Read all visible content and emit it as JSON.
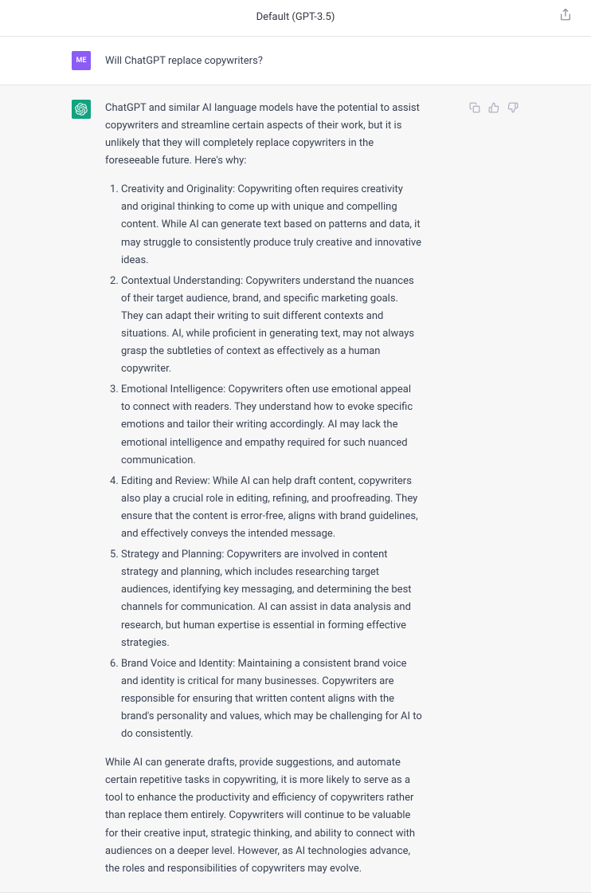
{
  "header": {
    "title": "Default (GPT-3.5)"
  },
  "user": {
    "avatar_text": "ME",
    "message": "Will ChatGPT replace copywriters?"
  },
  "assistant": {
    "intro": "ChatGPT and similar AI language models have the potential to assist copywriters and streamline certain aspects of their work, but it is unlikely that they will completely replace copywriters in the foreseeable future. Here's why:",
    "points": [
      "Creativity and Originality: Copywriting often requires creativity and original thinking to come up with unique and compelling content. While AI can generate text based on patterns and data, it may struggle to consistently produce truly creative and innovative ideas.",
      "Contextual Understanding: Copywriters understand the nuances of their target audience, brand, and specific marketing goals. They can adapt their writing to suit different contexts and situations. AI, while proficient in generating text, may not always grasp the subtleties of context as effectively as a human copywriter.",
      "Emotional Intelligence: Copywriters often use emotional appeal to connect with readers. They understand how to evoke specific emotions and tailor their writing accordingly. AI may lack the emotional intelligence and empathy required for such nuanced communication.",
      "Editing and Review: While AI can help draft content, copywriters also play a crucial role in editing, refining, and proofreading. They ensure that the content is error-free, aligns with brand guidelines, and effectively conveys the intended message.",
      "Strategy and Planning: Copywriters are involved in content strategy and planning, which includes researching target audiences, identifying key messaging, and determining the best channels for communication. AI can assist in data analysis and research, but human expertise is essential in forming effective strategies.",
      "Brand Voice and Identity: Maintaining a consistent brand voice and identity is critical for many businesses. Copywriters are responsible for ensuring that written content aligns with the brand's personality and values, which may be challenging for AI to do consistently."
    ],
    "conclusion": "While AI can generate drafts, provide suggestions, and automate certain repetitive tasks in copywriting, it is more likely to serve as a tool to enhance the productivity and efficiency of copywriters rather than replace them entirely. Copywriters will continue to be valuable for their creative input, strategic thinking, and ability to connect with audiences on a deeper level. However, as AI technologies advance, the roles and responsibilities of copywriters may evolve."
  }
}
